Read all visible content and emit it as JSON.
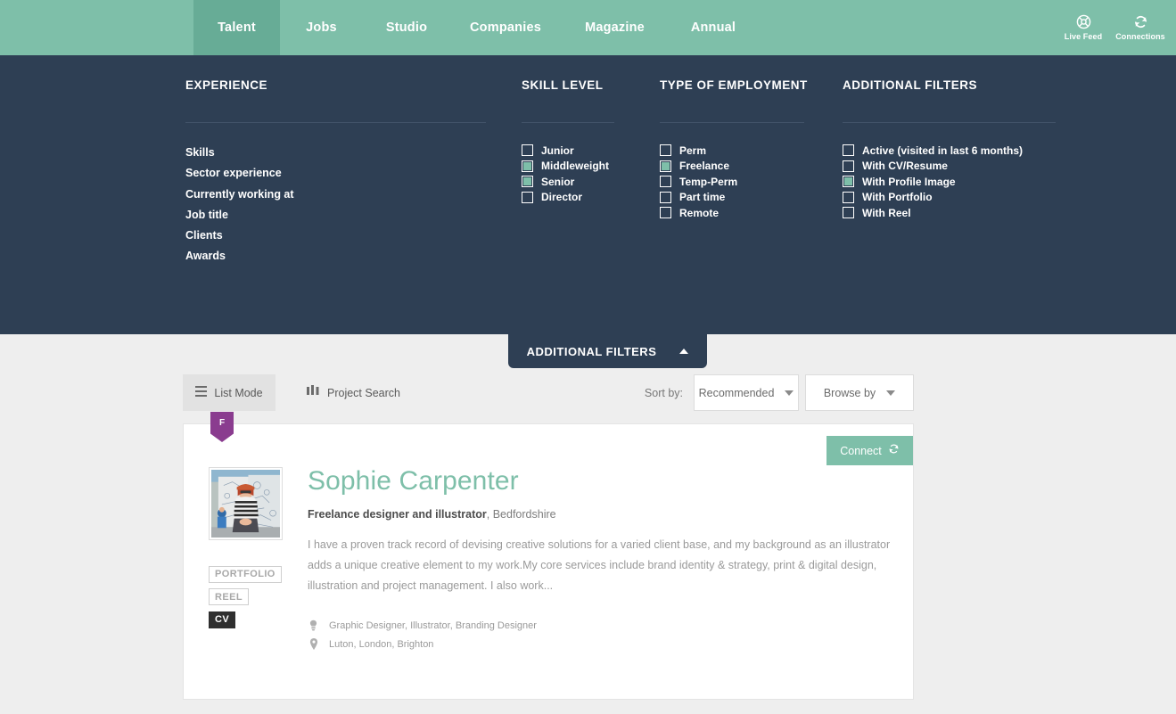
{
  "nav": {
    "tabs": [
      {
        "label": "Talent",
        "active": true
      },
      {
        "label": "Jobs",
        "active": false
      },
      {
        "label": "Studio",
        "active": false
      },
      {
        "label": "Companies",
        "active": false
      },
      {
        "label": "Magazine",
        "active": false
      },
      {
        "label": "Annual",
        "active": false
      }
    ],
    "right_items": [
      {
        "label": "Live Feed",
        "icon": "live-feed-icon"
      },
      {
        "label": "Connections",
        "icon": "connections-icon"
      }
    ]
  },
  "filters": {
    "experience": {
      "title": "EXPERIENCE",
      "links": [
        "Skills",
        "Sector experience",
        "Currently working at",
        "Job title",
        "Clients",
        "Awards"
      ]
    },
    "skill_level": {
      "title": "SKILL LEVEL",
      "options": [
        {
          "label": "Junior",
          "checked": false
        },
        {
          "label": "Middleweight",
          "checked": true
        },
        {
          "label": "Senior",
          "checked": true
        },
        {
          "label": "Director",
          "checked": false
        }
      ]
    },
    "employment": {
      "title": "TYPE OF EMPLOYMENT",
      "options": [
        {
          "label": "Perm",
          "checked": false
        },
        {
          "label": "Freelance",
          "checked": true
        },
        {
          "label": "Temp-Perm",
          "checked": false
        },
        {
          "label": "Part time",
          "checked": false
        },
        {
          "label": "Remote",
          "checked": false
        }
      ]
    },
    "additional": {
      "title": "ADDITIONAL FILTERS",
      "options": [
        {
          "label": "Active (visited in last 6 months)",
          "checked": false
        },
        {
          "label": "With CV/Resume",
          "checked": false
        },
        {
          "label": "With Profile Image",
          "checked": true
        },
        {
          "label": "With Portfolio",
          "checked": false
        },
        {
          "label": "With Reel",
          "checked": false
        }
      ]
    },
    "tab_label": "ADDITIONAL FILTERS"
  },
  "toolbar": {
    "list_mode_label": "List Mode",
    "project_search_label": "Project Search",
    "sort_by_label": "Sort by:",
    "sort_value": "Recommended",
    "browse_value": "Browse by"
  },
  "card": {
    "badge": "F",
    "connect_label": "Connect",
    "name": "Sophie Carpenter",
    "role": "Freelance designer and illustrator",
    "location": ", Bedfordshire",
    "bio": "I have a proven track record of devising creative solutions for a varied client base, and my background as an illustrator adds a unique creative element to my work.My core services include brand identity & strategy, print & digital design, illustration and project management. I also work...",
    "tags": [
      {
        "label": "PORTFOLIO",
        "style": "outline"
      },
      {
        "label": "REEL",
        "style": "outline"
      },
      {
        "label": "CV",
        "style": "filled"
      }
    ],
    "meta": [
      {
        "icon": "roles-icon",
        "text": "Graphic Designer, Illustrator, Branding Designer"
      },
      {
        "icon": "location-pin-icon",
        "text": "Luton, London, Brighton"
      }
    ]
  },
  "colors": {
    "brand_teal": "#7ebfa9",
    "active_tab_teal": "#67ac96",
    "panel_navy": "#2e3f54",
    "page_bg": "#eeeeee",
    "ribbon_purple": "#8a3c8f"
  }
}
